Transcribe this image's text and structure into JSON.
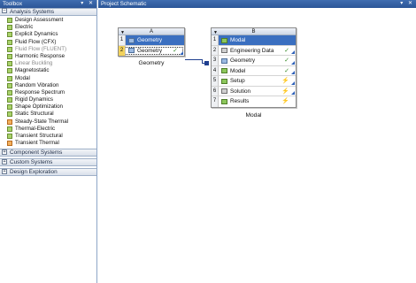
{
  "toolbox": {
    "title": "Toolbox",
    "controls": "▾ ✕",
    "sections": {
      "analysis": {
        "toggle": "−",
        "label": "Analysis Systems"
      },
      "component": {
        "toggle": "+",
        "label": "Component Systems"
      },
      "custom": {
        "toggle": "+",
        "label": "Custom Systems"
      },
      "design": {
        "toggle": "+",
        "label": "Design Exploration"
      }
    },
    "items": [
      {
        "label": "Design Assessment"
      },
      {
        "label": "Electric"
      },
      {
        "label": "Explicit Dynamics"
      },
      {
        "label": "Fluid Flow (CFX)"
      },
      {
        "label": "Fluid Flow (FLUENT)"
      },
      {
        "label": "Harmonic Response"
      },
      {
        "label": "Linear Buckling"
      },
      {
        "label": "Magnetostatic"
      },
      {
        "label": "Modal"
      },
      {
        "label": "Random Vibration"
      },
      {
        "label": "Response Spectrum"
      },
      {
        "label": "Rigid Dynamics"
      },
      {
        "label": "Shape Optimization"
      },
      {
        "label": "Static Structural"
      },
      {
        "label": "Steady-State Thermal"
      },
      {
        "label": "Thermal-Electric"
      },
      {
        "label": "Transient Structural"
      },
      {
        "label": "Transient Thermal"
      }
    ]
  },
  "schematic": {
    "title": "Project Schematic",
    "controls": "▾ ✕",
    "system_a": {
      "column": "A",
      "caption": "Geometry",
      "rows": [
        {
          "num": "1",
          "label": "Geometry",
          "status": ""
        },
        {
          "num": "2",
          "label": "Geometry",
          "status": "✓"
        }
      ]
    },
    "system_b": {
      "column": "B",
      "caption": "Modal",
      "rows": [
        {
          "num": "1",
          "label": "Modal",
          "status": ""
        },
        {
          "num": "2",
          "label": "Engineering Data",
          "status": "✓"
        },
        {
          "num": "3",
          "label": "Geometry",
          "status": "✓"
        },
        {
          "num": "4",
          "label": "Model",
          "status": "✓"
        },
        {
          "num": "5",
          "label": "Setup",
          "status": "⚡"
        },
        {
          "num": "6",
          "label": "Solution",
          "status": "⚡"
        },
        {
          "num": "7",
          "label": "Results",
          "status": "⚡"
        }
      ]
    }
  }
}
